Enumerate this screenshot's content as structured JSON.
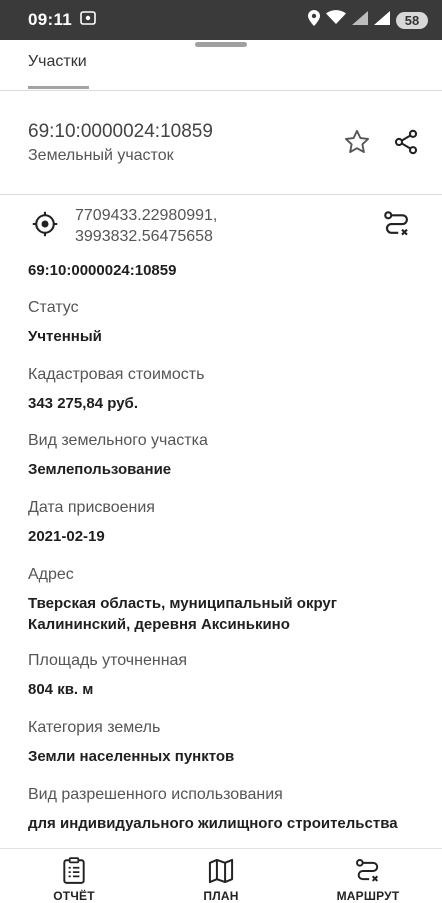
{
  "status_bar": {
    "time": "09:11",
    "battery": "58",
    "icons": [
      "screenshot-icon",
      "location-icon",
      "wifi-icon",
      "signal-icon",
      "signal-icon",
      "battery-icon"
    ]
  },
  "tabs": [
    {
      "label": "Участки",
      "active": true
    }
  ],
  "parcel": {
    "cadastral_number": "69:10:0000024:10859",
    "type": "Земельный участок"
  },
  "coordinates": {
    "line1": "7709433.22980991,",
    "line2": "3993832.56475658"
  },
  "details": {
    "number": "69:10:0000024:10859",
    "fields": [
      {
        "label": "Статус",
        "value": "Учтенный"
      },
      {
        "label": "Кадастровая стоимость",
        "value": "343 275,84 руб."
      },
      {
        "label": "Вид земельного участка",
        "value": "Землепользование"
      },
      {
        "label": "Дата присвоения",
        "value": "2021-02-19"
      },
      {
        "label": "Адрес",
        "value_line1": "Тверская область, муниципальный округ",
        "value_line2": "Калининский, деревня Аксинькино"
      },
      {
        "label": "Площадь уточненная",
        "value": "804 кв. м"
      },
      {
        "label": "Категория земель",
        "value": "Земли населенных пунктов"
      },
      {
        "label": "Вид разрешенного использования",
        "value": "для индивидуального жилищного строительства"
      }
    ]
  },
  "bottom_nav": [
    {
      "label": "ОТЧЁТ",
      "icon": "report-icon"
    },
    {
      "label": "ПЛАН",
      "icon": "map-icon"
    },
    {
      "label": "МАРШРУТ",
      "icon": "route-icon"
    }
  ],
  "colors": {
    "status_bar_bg": "#3a3a3a",
    "text_primary": "#1f1f1f",
    "text_secondary": "#555555"
  }
}
